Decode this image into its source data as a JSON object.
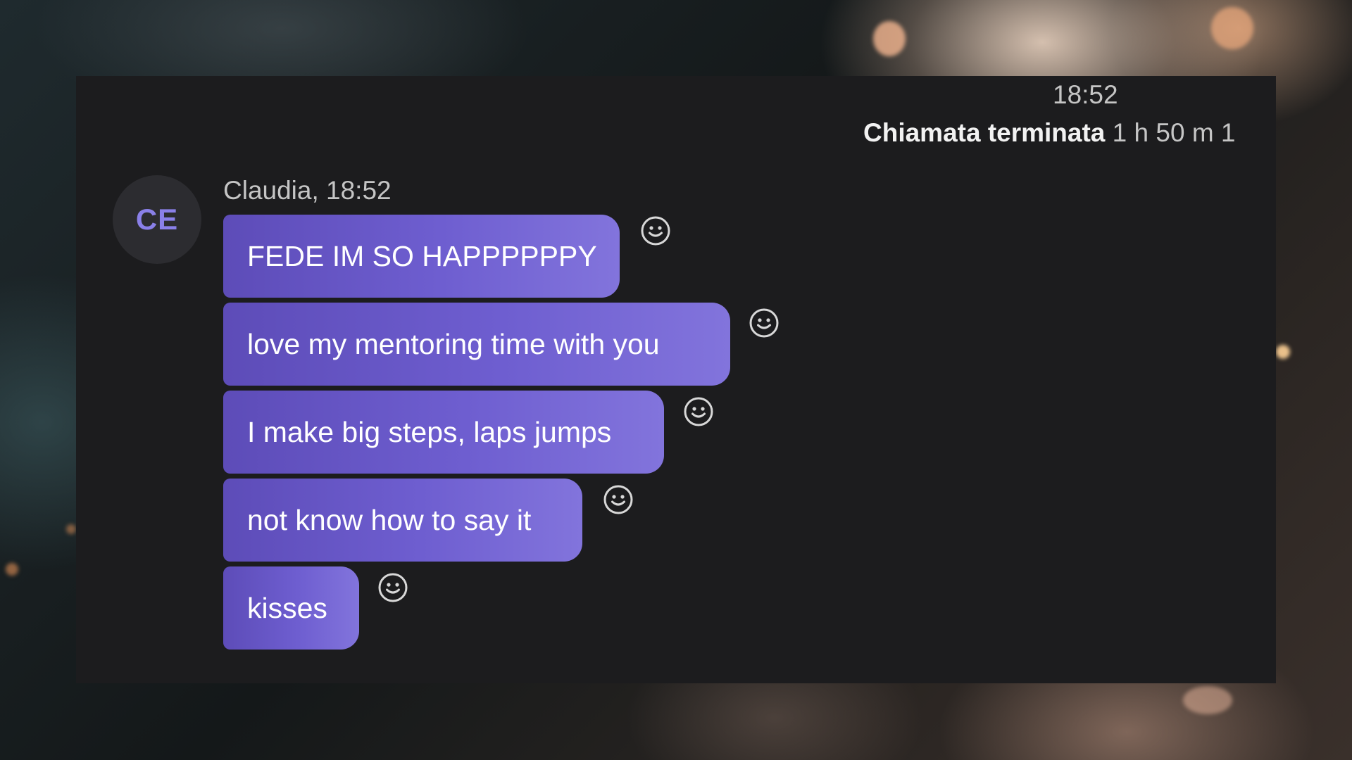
{
  "call": {
    "time": "18:52",
    "ended_label": "Chiamata terminata",
    "duration": "1 h 50 m 1"
  },
  "contact": {
    "initials": "CE",
    "sender_line": "Claudia, 18:52"
  },
  "messages": [
    {
      "text": "FEDE IM SO HAPPPPPPY",
      "reaction_icon": "smiley-icon"
    },
    {
      "text": "love my mentoring time with you",
      "reaction_icon": "smiley-icon"
    },
    {
      "text": "I make big steps, laps jumps",
      "reaction_icon": "smiley-icon"
    },
    {
      "text": "not know how to say it",
      "reaction_icon": "smiley-icon"
    },
    {
      "text": "kisses",
      "reaction_icon": "smiley-icon"
    }
  ],
  "colors": {
    "window_bg": "#1c1c1e",
    "bubble_start": "#5d4cb8",
    "bubble_end": "#8274dc",
    "avatar_text": "#8a80e8",
    "muted_text": "#c5c5c5"
  }
}
